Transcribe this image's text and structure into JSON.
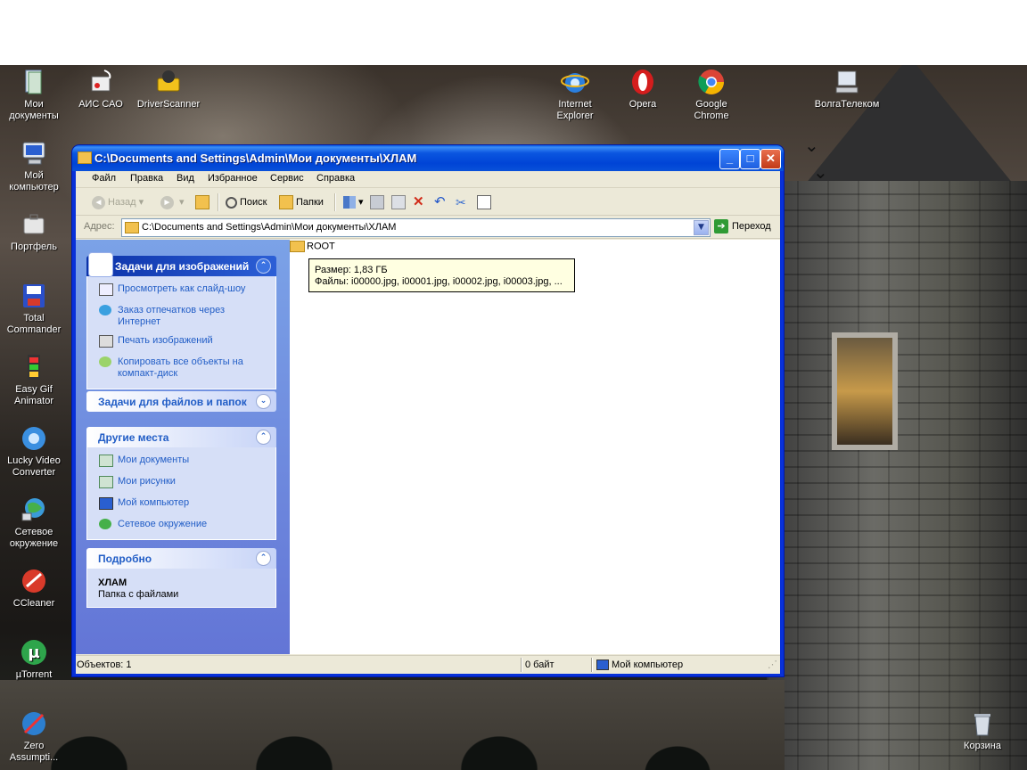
{
  "desktop": {
    "icons_left": [
      {
        "label": "Мои документы",
        "icon": "my-documents-icon"
      },
      {
        "label": "Мой компьютер",
        "icon": "my-computer-icon"
      },
      {
        "label": "Портфель",
        "icon": "briefcase-icon"
      },
      {
        "label": "Total Commander",
        "icon": "total-commander-icon"
      },
      {
        "label": "Easy Gif Animator",
        "icon": "easy-gif-animator-icon"
      },
      {
        "label": "Lucky Video Converter",
        "icon": "lucky-video-converter-icon"
      },
      {
        "label": "Сетевое окружение",
        "icon": "network-places-icon"
      },
      {
        "label": "CCleaner",
        "icon": "ccleaner-icon"
      },
      {
        "label": "µTorrent",
        "icon": "utorrent-icon"
      },
      {
        "label": "Zero Assumpti...",
        "icon": "zero-assumption-icon"
      }
    ],
    "icons_top": [
      {
        "label": "АИС САО",
        "icon": "ais-sao-icon"
      },
      {
        "label": "DriverScanner",
        "icon": "driverscanner-icon"
      },
      {
        "label": "Internet Explorer",
        "icon": "internet-explorer-icon"
      },
      {
        "label": "Opera",
        "icon": "opera-icon"
      },
      {
        "label": "Google Chrome",
        "icon": "google-chrome-icon"
      },
      {
        "label": "ВолгаТелеком",
        "icon": "volgatelecom-icon"
      }
    ],
    "recycle_bin": {
      "label": "Корзина",
      "icon": "recycle-bin-icon"
    }
  },
  "window": {
    "title": "C:\\Documents and Settings\\Admin\\Мои документы\\ХЛАМ",
    "menu": [
      "Файл",
      "Правка",
      "Вид",
      "Избранное",
      "Сервис",
      "Справка"
    ],
    "toolbar": {
      "back": "Назад",
      "search": "Поиск",
      "folders": "Папки"
    },
    "address": {
      "label": "Адрес:",
      "value": "C:\\Documents and Settings\\Admin\\Мои документы\\ХЛАМ",
      "go": "Переход"
    },
    "taskpane": {
      "image_tasks": {
        "title": "Задачи для изображений",
        "links": [
          {
            "label": "Просмотреть как слайд-шоу",
            "icon": "slideshow-icon"
          },
          {
            "label": "Заказ отпечатков через Интернет",
            "icon": "order-prints-icon"
          },
          {
            "label": "Печать изображений",
            "icon": "print-icon"
          },
          {
            "label": "Копировать все объекты на компакт-диск",
            "icon": "cd-copy-icon"
          }
        ]
      },
      "file_tasks": {
        "title": "Задачи для файлов и папок"
      },
      "other_places": {
        "title": "Другие места",
        "links": [
          {
            "label": "Мои документы",
            "icon": "my-documents-icon"
          },
          {
            "label": "Мои рисунки",
            "icon": "my-pictures-icon"
          },
          {
            "label": "Мой компьютер",
            "icon": "my-computer-icon"
          },
          {
            "label": "Сетевое окружение",
            "icon": "network-places-icon"
          }
        ]
      },
      "details": {
        "title": "Подробно",
        "name": "ХЛАМ",
        "type": "Папка с файлами"
      }
    },
    "content": {
      "folder": "ROOT",
      "tooltip": {
        "size": "Размер: 1,83 ГБ",
        "files": "Файлы: i00000.jpg, i00001.jpg, i00002.jpg, i00003.jpg, ..."
      }
    },
    "status": {
      "objects": "Объектов: 1",
      "size": "0 байт",
      "location": "Мой компьютер"
    }
  }
}
